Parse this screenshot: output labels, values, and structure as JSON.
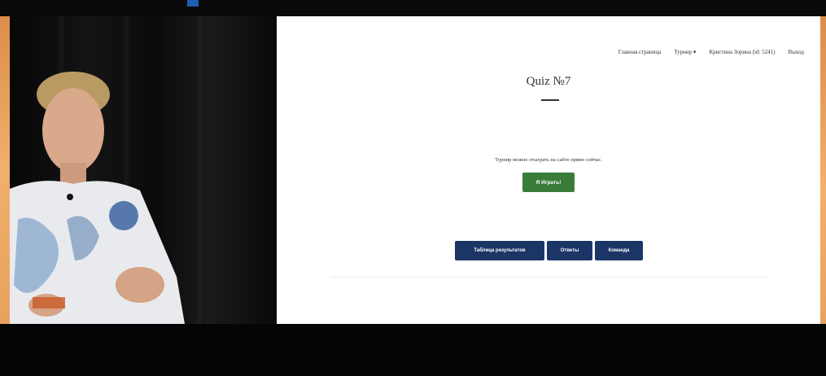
{
  "nav": {
    "home": "Главная страница",
    "tournaments": "Турнир ▾",
    "user": "Кристина Зорина (id: 5241)",
    "logout": "Выход"
  },
  "page": {
    "title": "Quiz №7",
    "info_text": "Турнир можно отыграть на сайте прямо сейчас.",
    "play_button": "Я Играть!"
  },
  "actions": {
    "results_table": "Таблица результатов",
    "answers": "Ответы",
    "teams": "Команда"
  },
  "colors": {
    "play_button": "#3a7d3a",
    "action_buttons": "#1b3566",
    "frame_border": "#e39a55"
  }
}
